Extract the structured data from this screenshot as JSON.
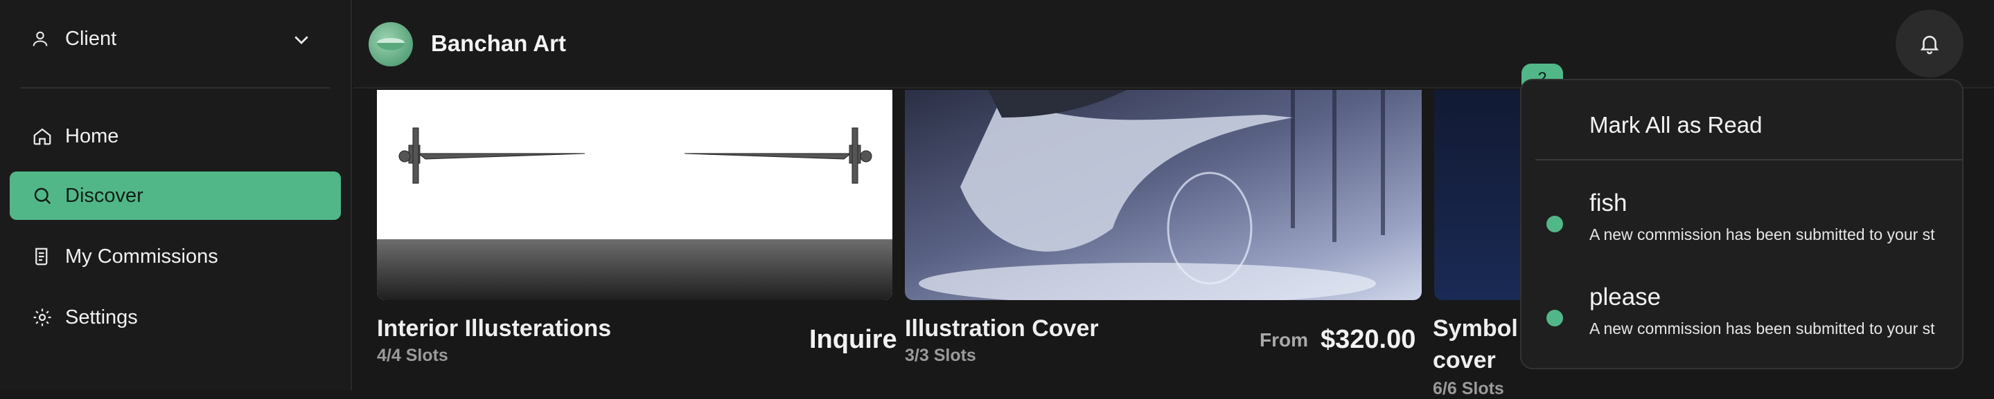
{
  "sidebar": {
    "account_label": "Client",
    "items": [
      {
        "label": "Home",
        "icon": "home-icon"
      },
      {
        "label": "Discover",
        "icon": "search-icon",
        "active": true
      },
      {
        "label": "My Commissions",
        "icon": "commissions-icon"
      },
      {
        "label": "Settings",
        "icon": "gear-icon"
      }
    ]
  },
  "header": {
    "brand": "Banchan Art",
    "notification_count": "2"
  },
  "cards": [
    {
      "title": "Interior Illusterations",
      "slots": "4/4 Slots",
      "action": "Inquire"
    },
    {
      "title": "Illustration Cover",
      "slots": "3/3 Slots",
      "price_prefix": "From",
      "price": "$320.00"
    },
    {
      "title_line1": "Symbol",
      "title_line2": "cover",
      "slots": "6/6 Slots"
    }
  ],
  "notifications": {
    "mark_all_label": "Mark All as Read",
    "items": [
      {
        "title": "fish",
        "body": "A new commission has been submitted to your st"
      },
      {
        "title": "please",
        "body": "A new commission has been submitted to your st"
      }
    ]
  },
  "colors": {
    "accent": "#52b788",
    "background": "#181818"
  }
}
